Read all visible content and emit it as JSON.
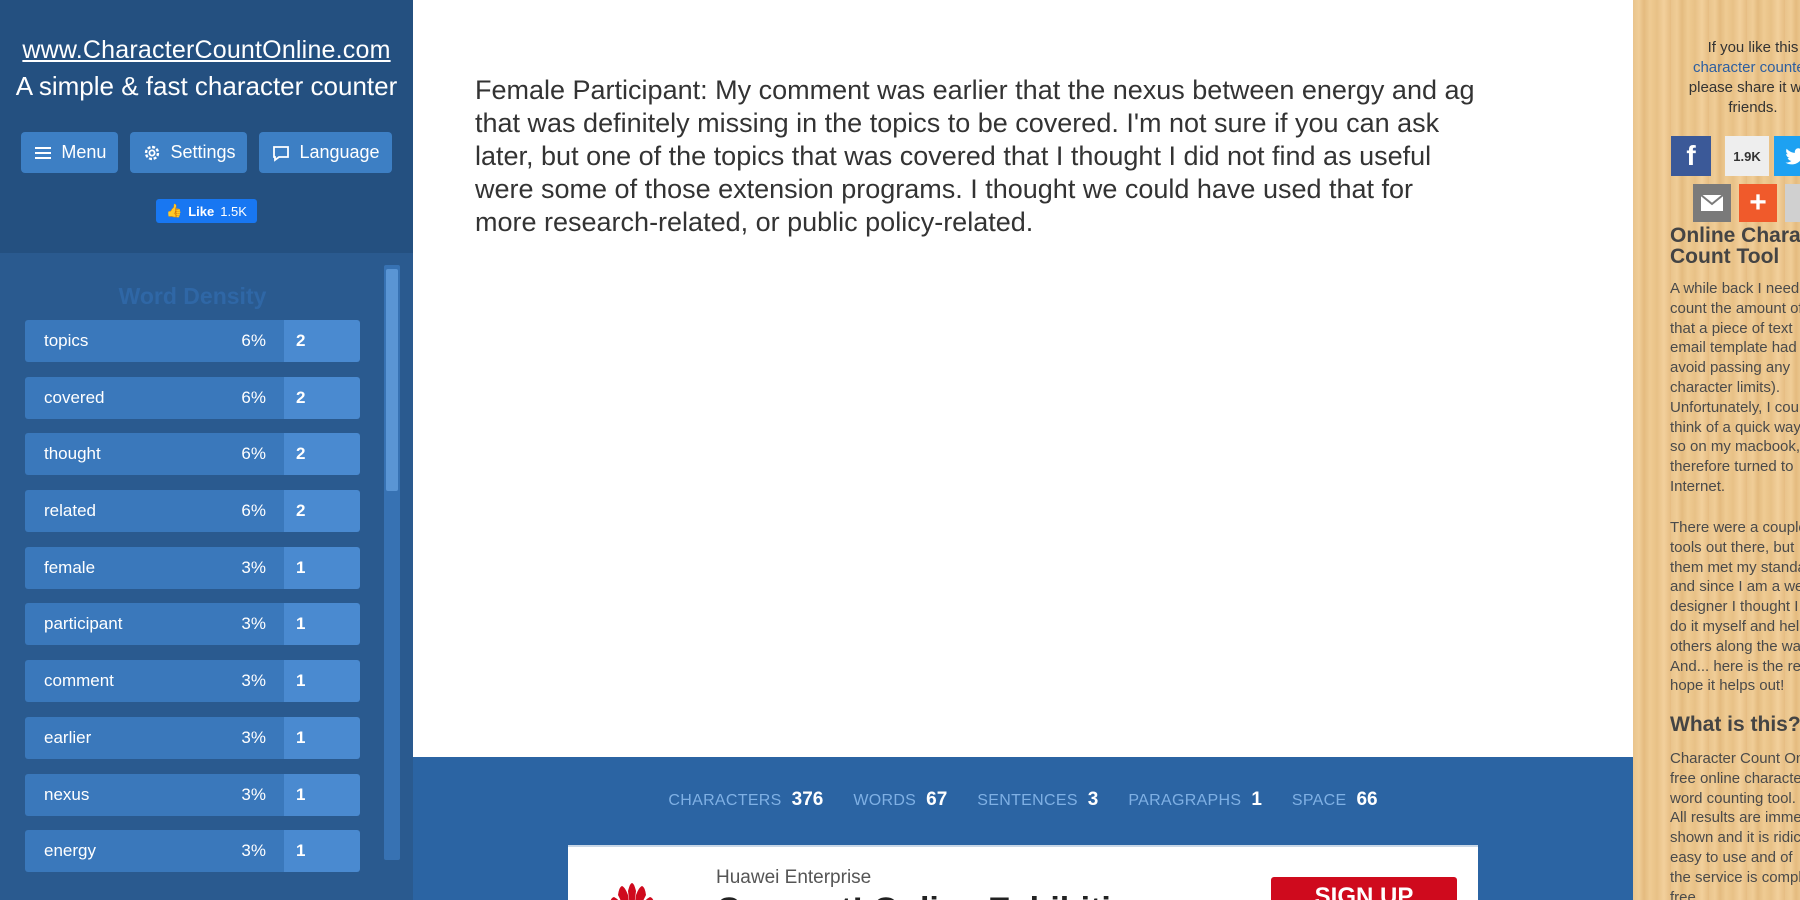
{
  "sidebar": {
    "site_url": "www.CharacterCountOnline.com",
    "tagline": "A simple & fast character counter",
    "buttons": {
      "menu": "Menu",
      "settings": "Settings",
      "language": "Language"
    },
    "fb_like": {
      "label": "Like",
      "count": "1.5K"
    },
    "density": {
      "title": "Word Density",
      "rows": [
        {
          "word": "topics",
          "pct": "6%",
          "count": "2"
        },
        {
          "word": "covered",
          "pct": "6%",
          "count": "2"
        },
        {
          "word": "thought",
          "pct": "6%",
          "count": "2"
        },
        {
          "word": "related",
          "pct": "6%",
          "count": "2"
        },
        {
          "word": "female",
          "pct": "3%",
          "count": "1"
        },
        {
          "word": "participant",
          "pct": "3%",
          "count": "1"
        },
        {
          "word": "comment",
          "pct": "3%",
          "count": "1"
        },
        {
          "word": "earlier",
          "pct": "3%",
          "count": "1"
        },
        {
          "word": "nexus",
          "pct": "3%",
          "count": "1"
        },
        {
          "word": "energy",
          "pct": "3%",
          "count": "1"
        }
      ]
    }
  },
  "main": {
    "text": "Female Participant: My comment was earlier that the nexus between energy and ag that was definitely missing in the topics to be covered. I'm not sure if you can ask later, but one of the topics that was covered that I thought I did not find as useful were some of those extension programs. I thought we could have used that for more research-related, or public policy-related.",
    "stats": {
      "characters_label": "CHARACTERS",
      "characters": "376",
      "words_label": "WORDS",
      "words": "67",
      "sentences_label": "SENTENCES",
      "sentences": "3",
      "paragraphs_label": "PARAGRAPHS",
      "paragraphs": "1",
      "space_label": "SPACE",
      "space": "66"
    },
    "ad": {
      "brand": "Huawei Enterprise",
      "headline": "Connect! Online Exhibition",
      "cta": "SIGN UP"
    }
  },
  "right_panel": {
    "share_text_1": "If you like this ",
    "share_link": "character counter,",
    "share_text_2": "please share it with friends.",
    "fb_count": "1.9K",
    "title": "Online Character Count Tool",
    "para1": "A while back I needed to\ncount the amount of\nthat a piece of text\nemail template had (to\navoid passing any\ncharacter limits).\nUnfortunately, I could\nthink of a quick way\nso on my macbook, I\ntherefore turned to\nInternet.",
    "para2": "There were a couple of\ntools out there, but\nthem met my standards\nand since I am a web\ndesigner I thought I\ndo it myself and help\nothers along the way.\nAnd... here is the result.\nhope it helps out!",
    "heading2": "What is this?",
    "para3": "Character Count Online\nfree online character\nword counting tool.\nAll results are immediately\nshown and it is ridiculously\neasy to use and of\nthe service is completely\nfree."
  },
  "colors": {
    "sidebar_bg": "#2a5a8f",
    "button_bg": "#3d7fc4",
    "stats_bar_bg": "#2b64a3",
    "ad_cta": "#cf0a1d"
  }
}
